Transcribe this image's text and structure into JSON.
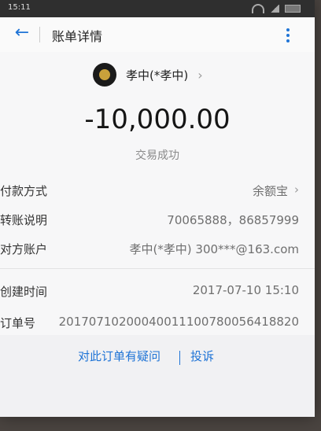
{
  "status_bar": {
    "time": "15:11"
  },
  "navbar": {
    "title": "账单详情"
  },
  "payee": {
    "name": "孝中(*孝中)"
  },
  "transaction": {
    "amount": "-10,000.00",
    "status": "交易成功"
  },
  "details": {
    "payment_method": {
      "label": "付款方式",
      "value": "余额宝"
    },
    "transfer_note": {
      "label": "转账说明",
      "value": "70065888，86857999"
    },
    "counterparty_account": {
      "label": "对方账户",
      "value": "孝中(*孝中) 300***@163.com"
    },
    "created_time": {
      "label": "创建时间",
      "value": "2017-07-10 15:10"
    },
    "order_number": {
      "label": "订单号",
      "value": "20170710200040011100780056418820"
    }
  },
  "links": {
    "doubt": "对此订单有疑问",
    "complaint": "投诉"
  },
  "colors": {
    "accent": "#1f74d6",
    "amount_text": "#151515",
    "status_bar": "#2f2f2f"
  }
}
